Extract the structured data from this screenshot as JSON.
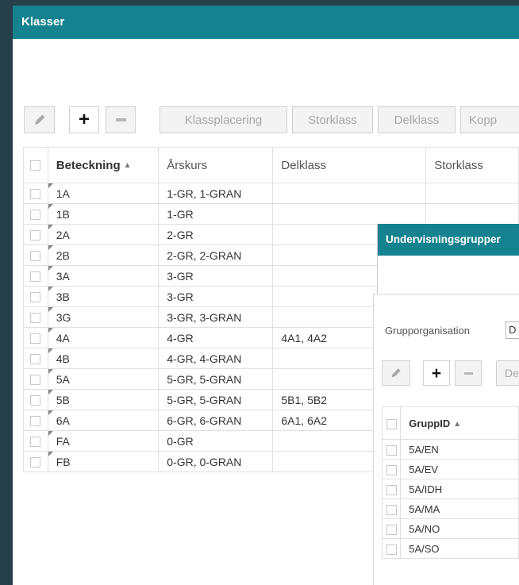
{
  "main_window": {
    "title": "Klasser",
    "toolbar": {
      "buttons": [
        "Klassplacering",
        "Storklass",
        "Delklass",
        "Kopp"
      ]
    },
    "table": {
      "columns": [
        "Beteckning",
        "Årskurs",
        "Delklass",
        "Storklass"
      ],
      "rows": [
        [
          "1A",
          "1-GR, 1-GRAN",
          "",
          ""
        ],
        [
          "1B",
          "1-GR",
          "",
          ""
        ],
        [
          "2A",
          "2-GR",
          "",
          ""
        ],
        [
          "2B",
          "2-GR, 2-GRAN",
          "",
          ""
        ],
        [
          "3A",
          "3-GR",
          "",
          ""
        ],
        [
          "3B",
          "3-GR",
          "",
          ""
        ],
        [
          "3G",
          "3-GR, 3-GRAN",
          "",
          ""
        ],
        [
          "4A",
          "4-GR",
          "4A1, 4A2",
          ""
        ],
        [
          "4B",
          "4-GR, 4-GRAN",
          "",
          ""
        ],
        [
          "5A",
          "5-GR, 5-GRAN",
          "",
          ""
        ],
        [
          "5B",
          "5-GR, 5-GRAN",
          "5B1, 5B2",
          ""
        ],
        [
          "6A",
          "6-GR, 6-GRAN",
          "6A1, 6A2",
          ""
        ],
        [
          "FA",
          "0-GR",
          "",
          ""
        ],
        [
          "FB",
          "0-GR, 0-GRAN",
          "",
          ""
        ]
      ]
    }
  },
  "sub_window": {
    "title": "Undervisningsgrupper",
    "org_label": "Grupporganisation",
    "org_value": "D",
    "toolbar_text": "De",
    "table": {
      "column": "GruppID",
      "rows": [
        "5A/EN",
        "5A/EV",
        "5A/IDH",
        "5A/MA",
        "5A/NO",
        "5A/SO"
      ]
    }
  },
  "colors": {
    "titlebar": "#14828f",
    "backdrop": "#263f4b"
  },
  "icons": [
    "pencil-icon",
    "plus-icon",
    "minus-icon",
    "sort-ascending-icon"
  ]
}
